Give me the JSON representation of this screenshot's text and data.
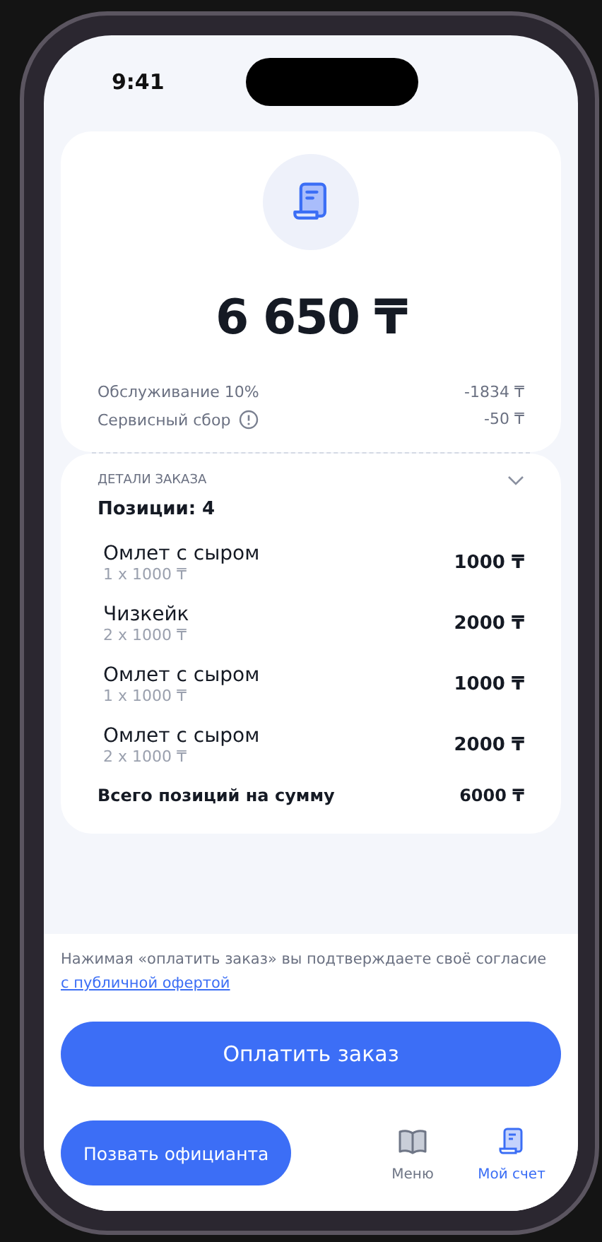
{
  "status_bar": {
    "time": "9:41"
  },
  "summary": {
    "total": "6 650 ₸",
    "fees": [
      {
        "label": "Обслуживание 10%",
        "value": "-1834 ₸",
        "info": false
      },
      {
        "label": "Сервисный сбор",
        "value": "-50 ₸",
        "info": true
      }
    ]
  },
  "order_details": {
    "heading": "ДЕТАЛИ ЗАКАЗА",
    "expanded": true,
    "count": "Позиции: 4",
    "items": [
      {
        "name": "Омлет с сыром",
        "qty": "1 x 1000 ₸",
        "price": "1000 ₸"
      },
      {
        "name": "Чизкейк",
        "qty": "2 x 1000 ₸",
        "price": "2000 ₸"
      },
      {
        "name": "Омлет с сыром",
        "qty": "1 x 1000 ₸",
        "price": "1000 ₸"
      },
      {
        "name": "Омлет с сыром",
        "qty": "2 x 1000 ₸",
        "price": "2000 ₸"
      }
    ],
    "total_label": "Всего позиций на сумму",
    "total_value": "6000 ₸"
  },
  "consent": {
    "text": "Нажимая «оплатить заказ» вы подтверждаете своё согласие",
    "link": "с публичной офертой"
  },
  "pay_button": "Оплатить заказ",
  "call_waiter_button": "Позвать официанта",
  "tabs": [
    {
      "label": "Меню",
      "kind": "menu",
      "selected": false
    },
    {
      "label": "Мой счет",
      "kind": "bill",
      "selected": true
    }
  ]
}
